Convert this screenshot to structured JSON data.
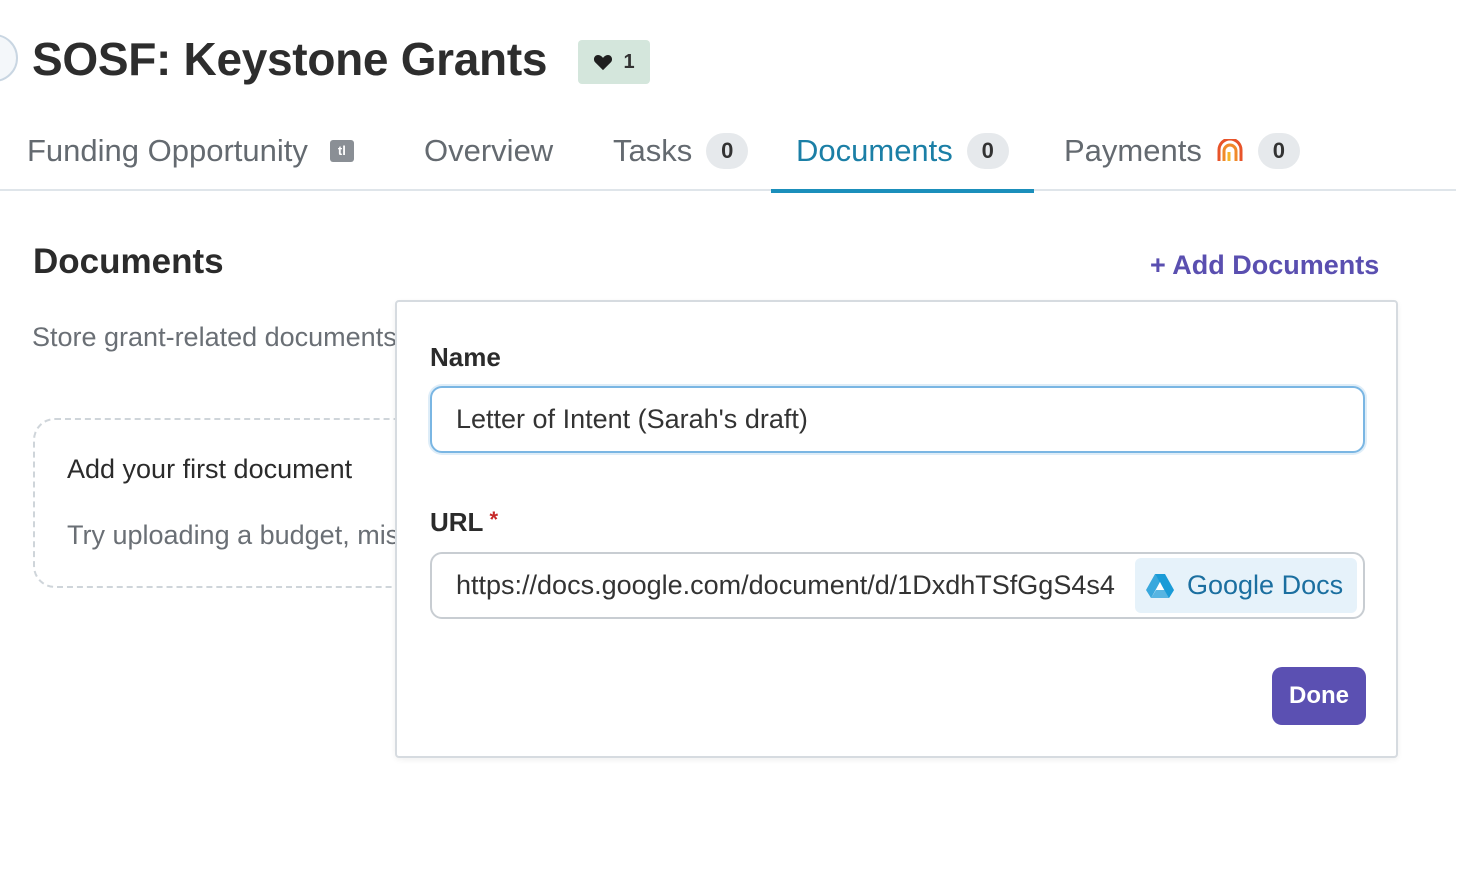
{
  "page": {
    "title": "SOSF: Keystone Grants",
    "like_count": "1"
  },
  "tabs": [
    {
      "label": "Funding Opportunity",
      "icon_text": "tl"
    },
    {
      "label": "Overview"
    },
    {
      "label": "Tasks",
      "count": "0"
    },
    {
      "label": "Documents",
      "count": "0",
      "active": true
    },
    {
      "label": "Payments",
      "count": "0"
    }
  ],
  "documents": {
    "title": "Documents",
    "add_label": "+ Add Documents",
    "description": "Store grant-related documents",
    "empty_title": "Add your first document",
    "empty_subtitle": "Try uploading a budget, mission statement"
  },
  "form": {
    "name_label": "Name",
    "name_value": "Letter of Intent (Sarah's draft)",
    "url_label": "URL",
    "required_mark": "*",
    "url_value": "https://docs.google.com/document/d/1DxdhTSfGgS4s4",
    "source_label": "Google Docs",
    "done_label": "Done"
  },
  "colors": {
    "accent": "#1b8fbb",
    "primary_button": "#5b50b2",
    "like_badge": "#d4e6dc",
    "required": "#c62828"
  }
}
